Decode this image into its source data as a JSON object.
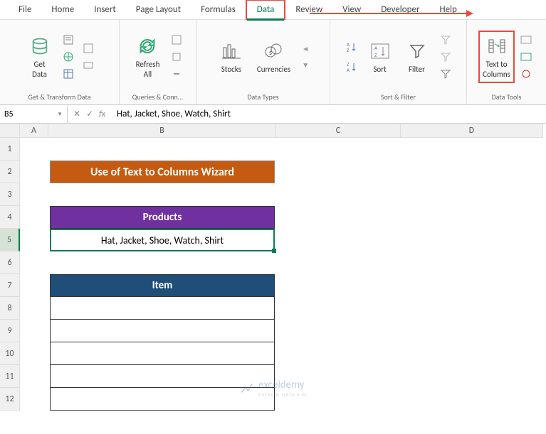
{
  "tabs": [
    "File",
    "Home",
    "Insert",
    "Page Layout",
    "Formulas",
    "Data",
    "Review",
    "View",
    "Developer",
    "Help"
  ],
  "active_tab": "Data",
  "ribbon": {
    "get_data": "Get\nData",
    "refresh": "Refresh\nAll",
    "stocks": "Stocks",
    "currencies": "Currencies",
    "sort": "Sort",
    "filter": "Filter",
    "text_to_columns": "Text to\nColumns",
    "group_labels": {
      "gtd": "Get & Transform Data",
      "qc": "Queries & Conn...",
      "dtypes": "Data Types",
      "sf": "Sort & Filter",
      "dtools": "Data Tools"
    }
  },
  "namebox": "B5",
  "formula": "Hat, Jacket, Shoe, Watch, Shirt",
  "columns": [
    "A",
    "B",
    "C",
    "D"
  ],
  "rows": [
    "1",
    "2",
    "3",
    "4",
    "5",
    "6",
    "7",
    "8",
    "9",
    "10",
    "11",
    "12"
  ],
  "content": {
    "title": "Use of Text to Columns Wizard",
    "products_header": "Products",
    "products_value": "Hat, Jacket, Shoe, Watch, Shirt",
    "item_header": "Item"
  },
  "watermark": {
    "brand": "exceldemy",
    "tagline": "EXCEL & DATA • BI"
  }
}
